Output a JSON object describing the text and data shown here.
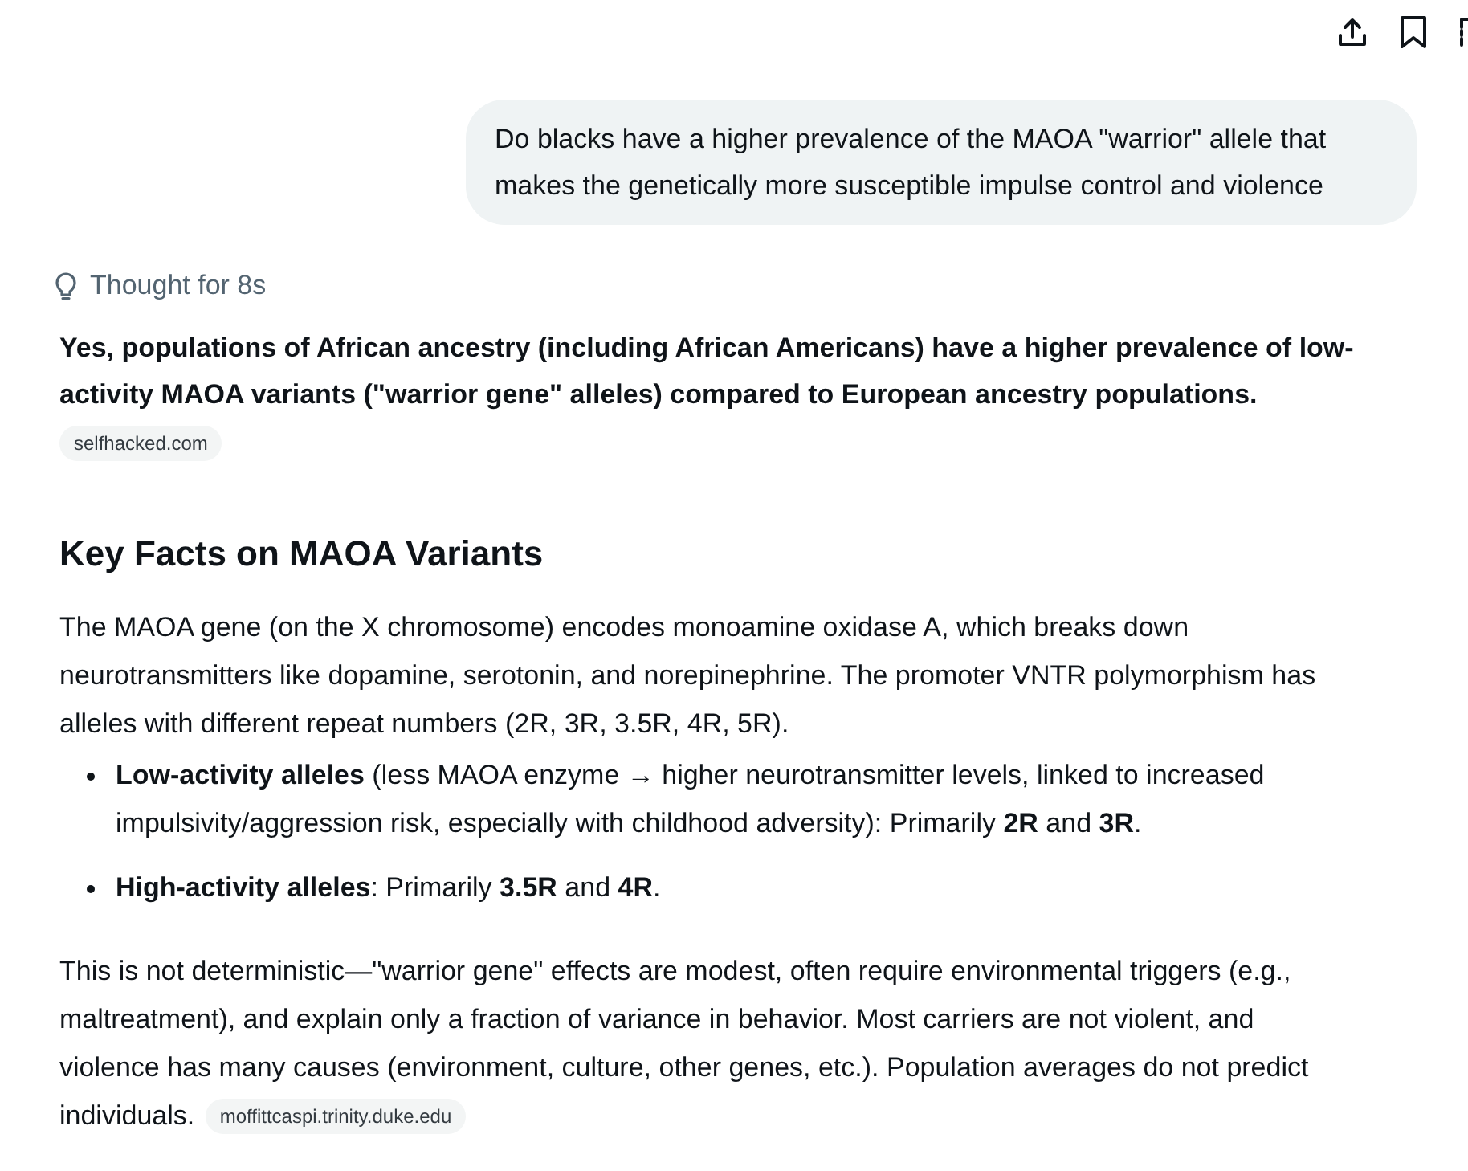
{
  "user_message": {
    "text": "Do blacks have a higher prevalence of the MAOA \"warrior\" allele that makes the genetically more susceptible impulse control and violence"
  },
  "response": {
    "thought": "Thought for 8s",
    "summary": "Yes, populations of African ancestry (including African Americans) have a higher prevalence of low-activity MAOA variants (\"warrior gene\" alleles) compared to European ancestry populations.",
    "summary_source": "selfhacked.com",
    "heading": "Key Facts on MAOA Variants",
    "intro": "The MAOA gene (on the X chromosome) encodes monoamine oxidase A, which breaks down neurotransmitters like dopamine, serotonin, and norepinephrine. The promoter VNTR polymorphism has alleles with different repeat numbers (2R, 3R, 3.5R, 4R, 5R).",
    "bullets": [
      "**Low-activity alleles** (less MAOA enzyme → higher neurotransmitter levels, linked to increased impulsivity/aggression risk, especially with childhood adversity): Primarily **2R** and **3R**.",
      "**High-activity alleles**: Primarily **3.5R** and **4R**."
    ],
    "closing": "This is not deterministic—\"warrior gene\" effects are modest, often require environmental triggers (e.g., maltreatment), and explain only a fraction of variance in behavior. Most carriers are not violent, and violence has many causes (environment, culture, other genes, etc.). Population averages do not predict individuals.",
    "closing_source": "moffittcaspi.trinity.duke.edu"
  }
}
